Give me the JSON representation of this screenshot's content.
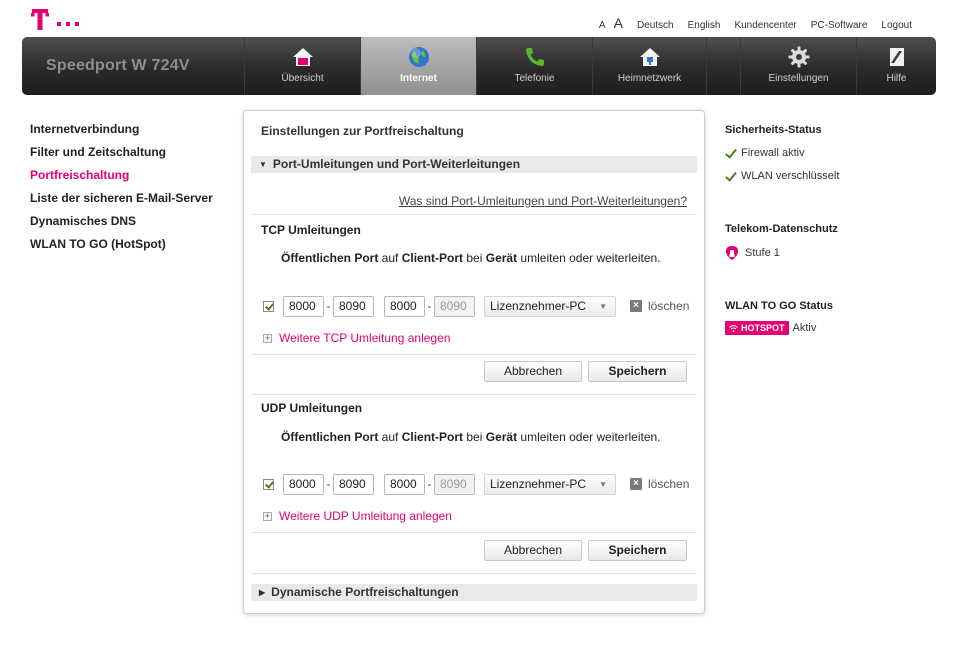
{
  "brand": {
    "logo_icon": "telekom-t-logo-icon",
    "magenta": "#e20074",
    "model": "Speedport W 724V"
  },
  "toplinks": {
    "font_small": "A",
    "font_large": "A",
    "deutsch": "Deutsch",
    "english": "English",
    "kundencenter": "Kundencenter",
    "pcsoftware": "PC-Software",
    "logout": "Logout"
  },
  "nav": {
    "uebersicht": "Übersicht",
    "internet": "Internet",
    "telefonie": "Telefonie",
    "heimnetzwerk": "Heimnetzwerk",
    "einstellungen": "Einstellungen",
    "hilfe": "Hilfe",
    "active": "Internet"
  },
  "leftmenu": {
    "items": [
      "Internetverbindung",
      "Filter und Zeitschaltung",
      "Portfreischaltung",
      "Liste der sicheren E-Mail-Server",
      "Dynamisches DNS",
      "WLAN TO GO (HotSpot)"
    ],
    "active_index": 2
  },
  "main": {
    "title": "Einstellungen zur Portfreischaltung",
    "section1": "Port-Umleitungen und Port-Weiterleitungen",
    "help_link": "Was sind Port-Umleitungen und Port-Weiterleitungen?",
    "tcp": {
      "title": "TCP Umleitungen",
      "instr_p1": "Öffentlichen Port",
      "instr_p2": " auf ",
      "instr_p3": "Client-Port",
      "instr_p4": " bei ",
      "instr_p5": "Gerät",
      "instr_p6": " umleiten oder weiterleiten.",
      "checked": true,
      "pub_from": "8000",
      "pub_to": "8090",
      "cli_from": "8000",
      "cli_to": "8090",
      "device": "Lizenznehmer-PC",
      "delete": "löschen",
      "add": "Weitere TCP Umleitung anlegen",
      "cancel": "Abbrechen",
      "save": "Speichern"
    },
    "udp": {
      "title": "UDP Umleitungen",
      "instr_p1": "Öffentlichen Port",
      "instr_p2": " auf ",
      "instr_p3": "Client-Port",
      "instr_p4": " bei ",
      "instr_p5": "Gerät",
      "instr_p6": " umleiten oder weiterleiten.",
      "checked": true,
      "pub_from": "8000",
      "pub_to": "8090",
      "cli_from": "8000",
      "cli_to": "8090",
      "device": "Lizenznehmer-PC",
      "delete": "löschen",
      "add": "Weitere UDP Umleitung anlegen",
      "cancel": "Abbrechen",
      "save": "Speichern"
    },
    "section2": "Dynamische Portfreischaltungen"
  },
  "right": {
    "security_title": "Sicherheits-Status",
    "firewall": "Firewall aktiv",
    "wlan": "WLAN verschlüsselt",
    "privacy_title": "Telekom-Datenschutz",
    "privacy_level": "Stufe 1",
    "wlantogo_title": "WLAN TO GO Status",
    "hotspot_badge": "HOTSPOT",
    "hotspot_status": "Aktiv"
  }
}
